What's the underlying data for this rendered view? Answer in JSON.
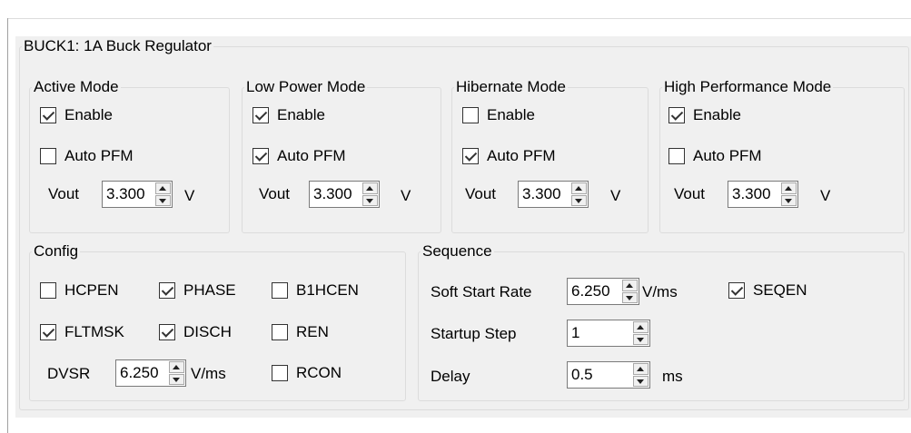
{
  "regulator": {
    "title": "BUCK1: 1A Buck Regulator",
    "modes": [
      {
        "title": "Active Mode",
        "enable_label": "Enable",
        "enable_checked": true,
        "pfm_label": "Auto PFM",
        "pfm_checked": false,
        "vout_label": "Vout",
        "vout_value": "3.300",
        "unit": "V"
      },
      {
        "title": "Low Power Mode",
        "enable_label": "Enable",
        "enable_checked": true,
        "pfm_label": "Auto PFM",
        "pfm_checked": true,
        "vout_label": "Vout",
        "vout_value": "3.300",
        "unit": "V"
      },
      {
        "title": "Hibernate Mode",
        "enable_label": "Enable",
        "enable_checked": false,
        "pfm_label": "Auto PFM",
        "pfm_checked": true,
        "vout_label": "Vout",
        "vout_value": "3.300",
        "unit": "V"
      },
      {
        "title": "High Performance Mode",
        "enable_label": "Enable",
        "enable_checked": true,
        "pfm_label": "Auto PFM",
        "pfm_checked": false,
        "vout_label": "Vout",
        "vout_value": "3.300",
        "unit": "V"
      }
    ],
    "config": {
      "title": "Config",
      "checkboxes": [
        {
          "label": "HCPEN",
          "checked": false
        },
        {
          "label": "PHASE",
          "checked": true
        },
        {
          "label": "B1HCEN",
          "checked": false
        },
        {
          "label": "FLTMSK",
          "checked": true
        },
        {
          "label": "DISCH",
          "checked": true
        },
        {
          "label": "REN",
          "checked": false
        },
        {
          "label": "RCON",
          "checked": false
        }
      ],
      "dvsr_label": "DVSR",
      "dvsr_value": "6.250",
      "dvsr_unit": "V/ms"
    },
    "sequence": {
      "title": "Sequence",
      "soft_start_label": "Soft Start Rate",
      "soft_start_value": "6.250",
      "soft_start_unit": "V/ms",
      "seqen_label": "SEQEN",
      "seqen_checked": true,
      "startup_step_label": "Startup Step",
      "startup_step_value": "1",
      "delay_label": "Delay",
      "delay_value": "0.5",
      "delay_unit": "ms"
    }
  },
  "icons": {
    "spin_up": "triangle-up",
    "spin_down": "triangle-down",
    "check": "checkmark"
  }
}
